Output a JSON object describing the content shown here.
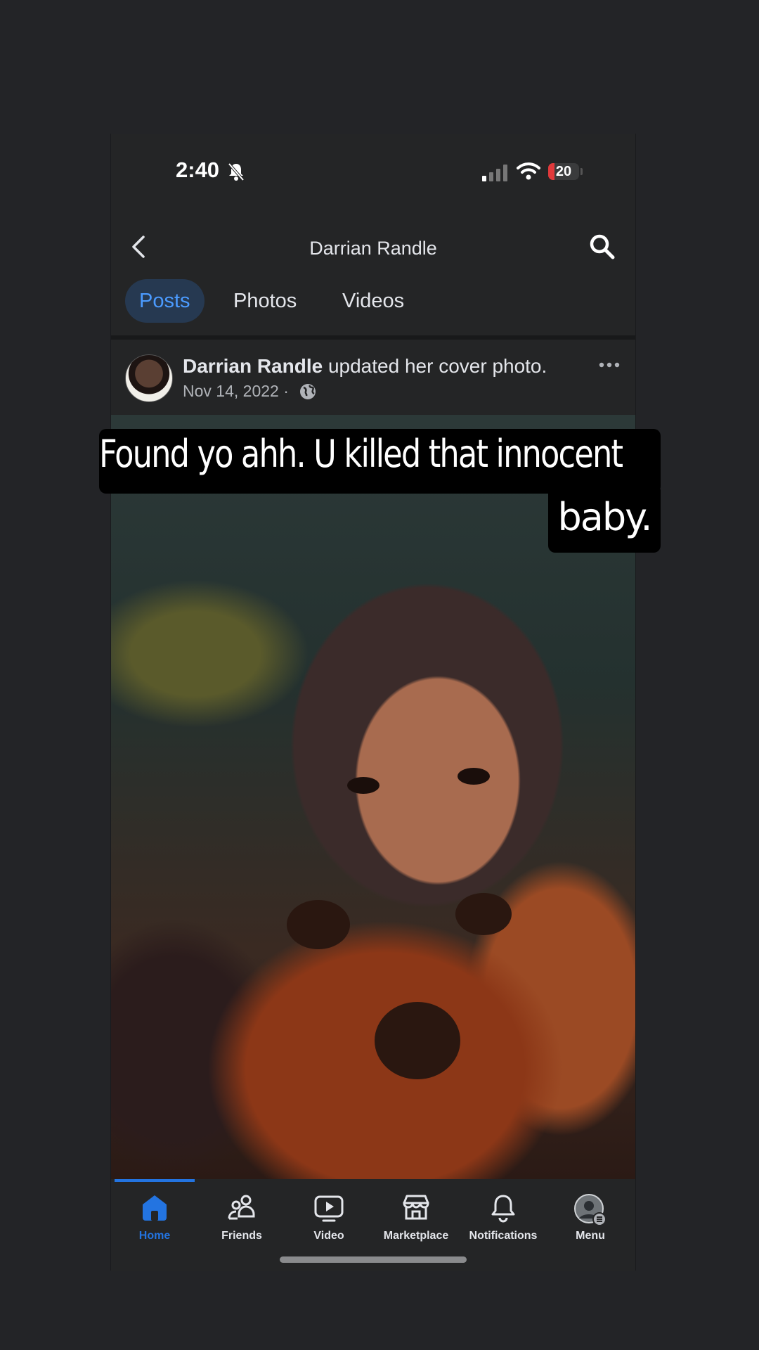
{
  "status_bar": {
    "time": "2:40",
    "battery": "20",
    "battery_level_percent": 20
  },
  "header": {
    "title": "Darrian Randle"
  },
  "tabs": [
    {
      "label": "Posts",
      "active": true
    },
    {
      "label": "Photos",
      "active": false
    },
    {
      "label": "Videos",
      "active": false
    }
  ],
  "post": {
    "author": "Darrian Randle",
    "action": " updated her cover photo.",
    "date": "Nov 14, 2022 ·"
  },
  "caption": {
    "line1": "Found yo ahh. U killed that innocent",
    "line2": "baby."
  },
  "bottom_nav": {
    "home": "Home",
    "friends": "Friends",
    "video": "Video",
    "marketplace": "Marketplace",
    "notifications": "Notifications",
    "menu": "Menu"
  },
  "colors": {
    "accent": "#2374e1",
    "background": "#242526",
    "battery_low": "#e0393b"
  }
}
